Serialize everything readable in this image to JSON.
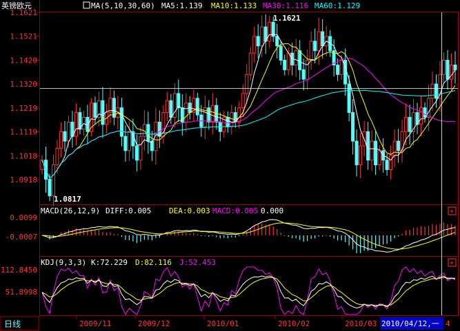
{
  "main": {
    "symbol": "英镑欧元",
    "ma_label": "MA(5,10,30,60)",
    "ma5": "MA5:1.139",
    "ma10": "MA10:1.133",
    "ma30": "MA30:1.116",
    "ma60": "MA60:1.129",
    "y_ticks": [
      "1.1621",
      "1.1521",
      "1.1420",
      "1.1320",
      "1.1219",
      "1.1119",
      "1.1018",
      "1.0918"
    ],
    "high_label": "1.1621",
    "low_label": "1.0817"
  },
  "macd": {
    "label": "MACD(26,12,9)",
    "diff": "DIFF:0.005",
    "dea": "DEA:0.003",
    "macd": "MACD:0.005",
    "extra": "0.000",
    "y_ticks": [
      "0.0099",
      "-0.0007"
    ]
  },
  "kdj": {
    "label": "KDJ(9,3,3)",
    "k": "K:72.229",
    "d": "D:82.116",
    "j": "J:52.453",
    "y_ticks": [
      "112.8450",
      "51.8998"
    ]
  },
  "bottom": {
    "period_tab": "日线",
    "x_labels": [
      "2009/11",
      "2009/12",
      "2010/01",
      "2010/02",
      "2010/03"
    ],
    "cursor_date": "2010/04/12,一",
    "cursor_suffix": "4"
  },
  "colors": {
    "up": "#ff3232",
    "down": "#54fcfc",
    "ma5": "#ffffff",
    "ma10": "#ffff00",
    "ma30": "#ff00ff",
    "ma60": "#00ffff",
    "axis": "#a00000",
    "tick_text": "#ff3232"
  },
  "chart_data": [
    {
      "type": "candlestick",
      "title": "英镑欧元",
      "x": [
        "2009/11",
        "2009/12",
        "2010/01",
        "2010/02",
        "2010/03",
        "2010/04/12"
      ],
      "ylim": [
        1.0817,
        1.1621
      ],
      "y_ticks": [
        1.1621,
        1.1521,
        1.142,
        1.132,
        1.1219,
        1.1119,
        1.1018,
        1.0918
      ],
      "annotations": [
        {
          "text": "1.1621",
          "type": "high"
        },
        {
          "text": "1.0817",
          "type": "low"
        }
      ],
      "close": [
        1.1,
        1.092,
        1.085,
        1.098,
        1.105,
        1.112,
        1.108,
        1.116,
        1.11,
        1.12,
        1.113,
        1.118,
        1.112,
        1.124,
        1.118,
        1.125,
        1.115,
        1.12,
        1.126,
        1.118,
        1.122,
        1.11,
        1.104,
        1.112,
        1.106,
        1.1,
        1.11,
        1.115,
        1.108,
        1.104,
        1.116,
        1.11,
        1.12,
        1.125,
        1.118,
        1.128,
        1.122,
        1.116,
        1.124,
        1.12,
        1.126,
        1.119,
        1.114,
        1.122,
        1.116,
        1.123,
        1.116,
        1.112,
        1.118,
        1.114,
        1.12,
        1.116,
        1.122,
        1.128,
        1.136,
        1.145,
        1.152,
        1.148,
        1.156,
        1.15,
        1.158,
        1.152,
        1.148,
        1.142,
        1.138,
        1.145,
        1.14,
        1.146,
        1.138,
        1.134,
        1.142,
        1.15,
        1.146,
        1.154,
        1.148,
        1.152,
        1.146,
        1.14,
        1.136,
        1.142,
        1.132,
        1.12,
        1.108,
        1.098,
        1.106,
        1.112,
        1.1,
        1.108,
        1.098,
        1.104,
        1.1,
        1.096,
        1.102,
        1.108,
        1.104,
        1.112,
        1.118,
        1.112,
        1.12,
        1.115,
        1.122,
        1.118,
        1.126,
        1.132,
        1.126,
        1.136,
        1.142,
        1.134,
        1.14,
        1.138
      ],
      "series": [
        {
          "name": "MA5",
          "last": 1.139
        },
        {
          "name": "MA10",
          "last": 1.133
        },
        {
          "name": "MA30",
          "last": 1.116
        },
        {
          "name": "MA60",
          "last": 1.129
        }
      ]
    },
    {
      "type": "bar",
      "title": "MACD(26,12,9)",
      "y_ticks": [
        0.0099,
        -0.0007
      ],
      "series": [
        {
          "name": "DIFF",
          "last": 0.005
        },
        {
          "name": "DEA",
          "last": 0.003
        },
        {
          "name": "MACD",
          "last": 0.005
        }
      ]
    },
    {
      "type": "line",
      "title": "KDJ(9,3,3)",
      "y_ticks": [
        112.845,
        51.8998
      ],
      "series": [
        {
          "name": "K",
          "last": 72.229
        },
        {
          "name": "D",
          "last": 82.116
        },
        {
          "name": "J",
          "last": 52.453
        }
      ]
    }
  ]
}
